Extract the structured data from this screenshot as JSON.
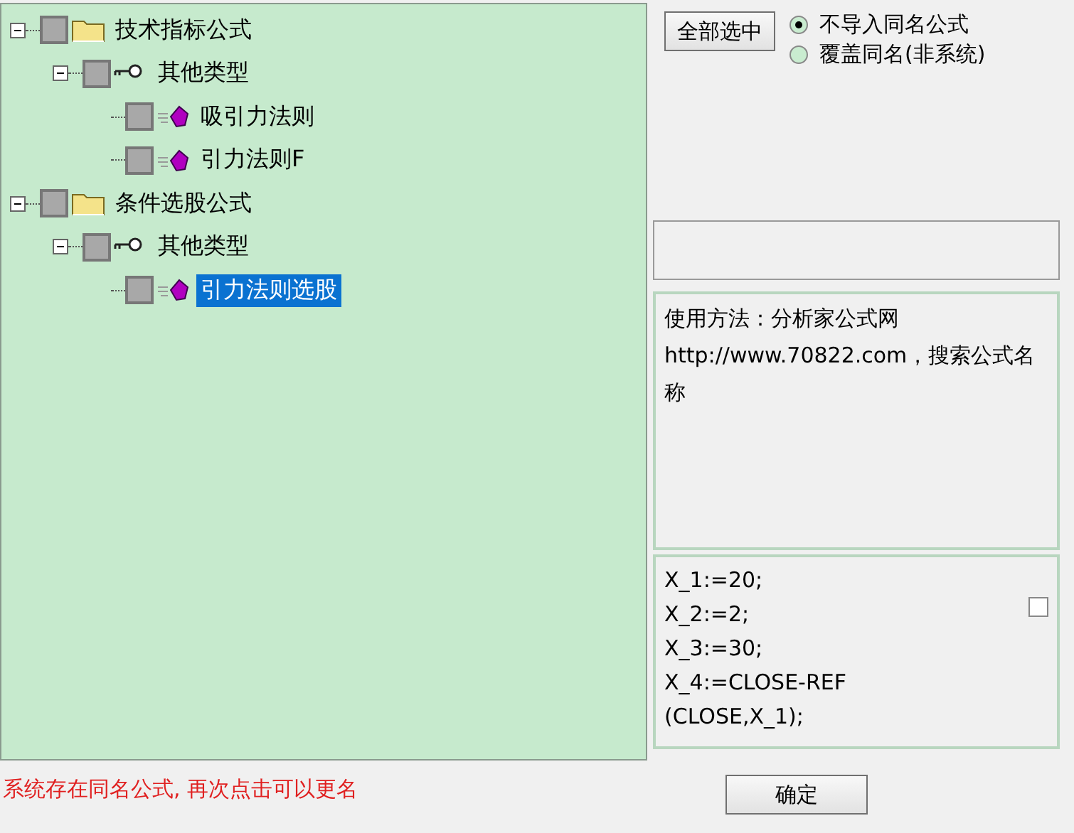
{
  "tree": [
    {
      "label": "技术指标公式",
      "kind": "folder",
      "expanded": true,
      "checked": false,
      "selected": false,
      "children": [
        {
          "label": "其他类型",
          "kind": "category",
          "expanded": true,
          "checked": false,
          "selected": false,
          "children": [
            {
              "label": "吸引力法则",
              "kind": "formula",
              "checked": false,
              "selected": false
            },
            {
              "label": "引力法则F",
              "kind": "formula",
              "checked": false,
              "selected": false
            }
          ]
        }
      ]
    },
    {
      "label": "条件选股公式",
      "kind": "folder",
      "expanded": true,
      "checked": false,
      "selected": false,
      "children": [
        {
          "label": "其他类型",
          "kind": "category",
          "expanded": true,
          "checked": false,
          "selected": false,
          "children": [
            {
              "label": "引力法则选股",
              "kind": "formula",
              "checked": false,
              "selected": true
            }
          ]
        }
      ]
    }
  ],
  "select_all_button": "全部选中",
  "options": [
    {
      "label": "不导入同名公式",
      "selected": true
    },
    {
      "label": "覆盖同名(非系统)",
      "selected": false
    }
  ],
  "description": "使用方法：分析家公式网http://www.70822.com，搜索公式名称",
  "code": [
    "X_1:=20;",
    "X_2:=2;",
    "X_3:=30;",
    "X_4:=CLOSE-REF",
    "(CLOSE,X_1);"
  ],
  "code_checkbox": {
    "checked": false
  },
  "status": "系统存在同名公式, 再次点击可以更名",
  "ok_button": "确定"
}
